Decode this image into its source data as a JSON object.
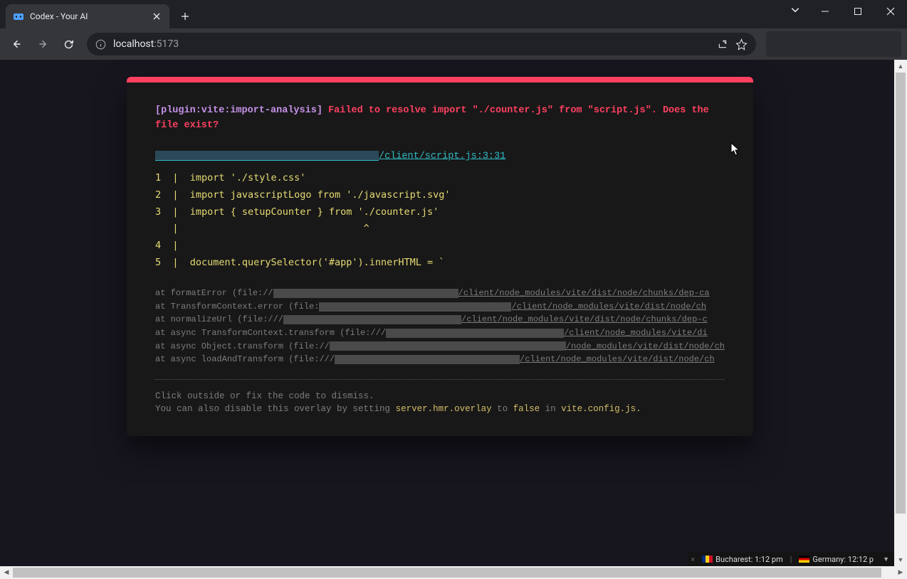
{
  "browser": {
    "tab": {
      "title": "Codex - Your AI"
    },
    "address": {
      "host": "localhost",
      "port": ":5173"
    }
  },
  "error": {
    "plugin_tag": "[plugin:vite:import-analysis]",
    "message": "Failed to resolve import \"./counter.js\" from \"script.js\". Does the file exist?",
    "file": "/client/script.js:3:31",
    "code": "1  |  import './style.css'\n2  |  import javascriptLogo from './javascript.svg'\n3  |  import { setupCounter } from './counter.js'\n   |                                ^\n4  |\n5  |  document.querySelector('#app').innerHTML = `",
    "stack": [
      {
        "pre": "      at formatError (file://",
        "rw": 260,
        "post": "/client/node_modules/vite/dist/node/chunks/dep-ca"
      },
      {
        "pre": "      at TransformContext.error (file:",
        "rw": 270,
        "post": "/client/node_modules/vite/dist/node/ch"
      },
      {
        "pre": "      at normalizeUrl (file:///",
        "rw": 250,
        "post": "/client/node_modules/vite/dist/node/chunks/dep-c"
      },
      {
        "pre": "      at async TransformContext.transform (file:///",
        "rw": 250,
        "post": "/client/node_modules/vite/di"
      },
      {
        "pre": "      at async Object.transform (file://",
        "rw": 350,
        "post": "/node_modules/vite/dist/node/ch"
      },
      {
        "pre": "      at async loadAndTransform (file:///",
        "rw": 260,
        "post": "/client/node_modules/vite/dist/node/ch"
      }
    ],
    "tip_line1": "Click outside or fix the code to dismiss.",
    "tip_line2_pre": "You can also disable this overlay by setting ",
    "tip_code1": "server.hmr.overlay",
    "tip_to": " to ",
    "tip_code2": "false",
    "tip_in": " in ",
    "tip_code3": "vite.config.js."
  },
  "taskbar": {
    "close": "×",
    "items": [
      {
        "flag": "ro",
        "label": "Bucharest: 1:12 pm"
      },
      {
        "flag": "de",
        "label": "Germany: 12:12 p"
      }
    ]
  }
}
